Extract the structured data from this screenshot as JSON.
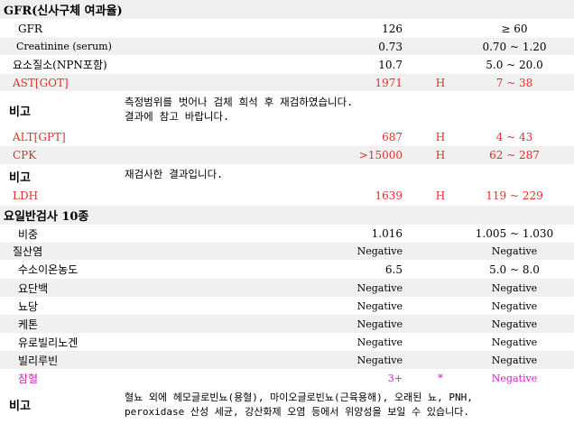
{
  "sections": {
    "gfr_title": "GFR(신사구체 여과율)",
    "urine_title": "요일반검사 10종"
  },
  "rows": [
    {
      "name": "GFR",
      "value": "126",
      "flag": "",
      "ref": "≥ 60"
    },
    {
      "name": "Creatinine (serum)",
      "value": "0.73",
      "flag": "",
      "ref": "0.70 ~ 1.20"
    },
    {
      "name": "요소질소(NPN포함)",
      "value": "10.7",
      "flag": "",
      "ref": "5.0 ~ 20.0"
    },
    {
      "name": "AST[GOT]",
      "value": "1971",
      "flag": "H",
      "ref": "7 ~ 38"
    },
    {
      "name": "ALT[GPT]",
      "value": "687",
      "flag": "H",
      "ref": "4 ~ 43"
    },
    {
      "name": "CPK",
      "value": ">15000",
      "flag": "H",
      "ref": "62 ~ 287"
    },
    {
      "name": "LDH",
      "value": "1639",
      "flag": "H",
      "ref": "119 ~ 229"
    },
    {
      "name": "비중",
      "value": "1.016",
      "flag": "",
      "ref": "1.005 ~ 1.030"
    },
    {
      "name": "질산염",
      "value": "Negative",
      "flag": "",
      "ref": "Negative"
    },
    {
      "name": "수소이온농도",
      "value": "6.5",
      "flag": "",
      "ref": "5.0 ~ 8.0"
    },
    {
      "name": "요단백",
      "value": "Negative",
      "flag": "",
      "ref": "Negative"
    },
    {
      "name": "뇨당",
      "value": "Negative",
      "flag": "",
      "ref": "Negative"
    },
    {
      "name": "케톤",
      "value": "Negative",
      "flag": "",
      "ref": "Negative"
    },
    {
      "name": "유로빌리노겐",
      "value": "Negative",
      "flag": "",
      "ref": "Negative"
    },
    {
      "name": "빌리루빈",
      "value": "Negative",
      "flag": "",
      "ref": "Negative"
    },
    {
      "name": "잠혈",
      "value": "3+",
      "flag": "*",
      "ref": "Negative"
    }
  ],
  "notes": {
    "label": "비고",
    "note1_line1": "측정범위를 벗어나 검체 희석 후 재검하였습니다.",
    "note1_line2": "결과에 참고 바랍니다.",
    "note2_line1": "재검사한 결과입니다.",
    "note3_line1": "혈뇨 외에 헤모글로빈뇨(용혈), 마이오글로빈뇨(근육용해), 오래된 뇨, PNH,",
    "note3_line2": "peroxidase 산성 세균, 강산화제 오염 등에서 위양성을 보일 수 있습니다."
  },
  "colors": {
    "high": "#e0302a",
    "flagged": "#d020c8",
    "band": "#f0f0f0"
  }
}
